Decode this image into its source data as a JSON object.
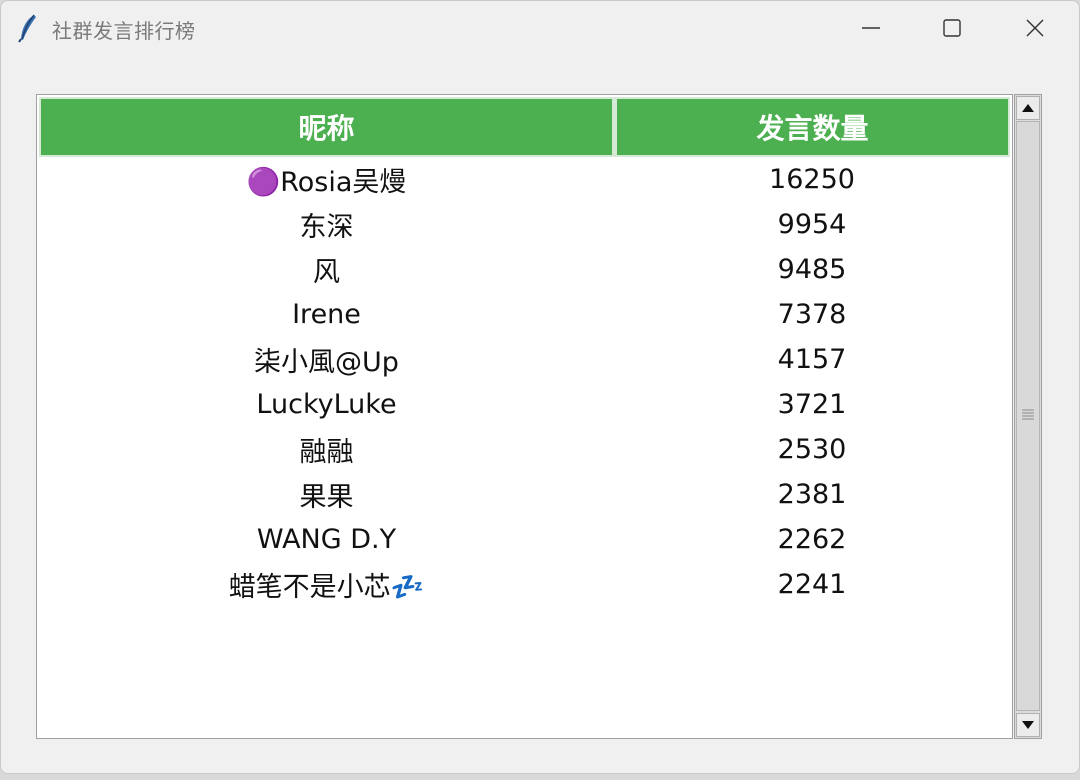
{
  "window": {
    "title": "社群发言排行榜"
  },
  "table": {
    "columns": [
      "昵称",
      "发言数量"
    ],
    "rows": [
      {
        "name": "🟣Rosia吴熳",
        "count": "16250"
      },
      {
        "name": "东深",
        "count": "9954"
      },
      {
        "name": "风",
        "count": "9485"
      },
      {
        "name": "Irene",
        "count": "7378"
      },
      {
        "name": "柒小風@Up",
        "count": "4157"
      },
      {
        "name": "LuckyLuke",
        "count": "3721"
      },
      {
        "name": "融融",
        "count": "2530"
      },
      {
        "name": "果果",
        "count": "2381"
      },
      {
        "name": "WANG D.Y",
        "count": "2262"
      },
      {
        "name": "蜡笔不是小芯💤",
        "count": "2241"
      }
    ]
  },
  "colors": {
    "header_bg": "#4caf50",
    "header_text": "#ffffff"
  },
  "icons": {
    "app": "feather-icon",
    "minimize": "minimize-icon",
    "maximize": "maximize-icon",
    "close": "close-icon",
    "scroll_up": "arrow-up-icon",
    "scroll_down": "arrow-down-icon",
    "grip": "grip-icon"
  }
}
